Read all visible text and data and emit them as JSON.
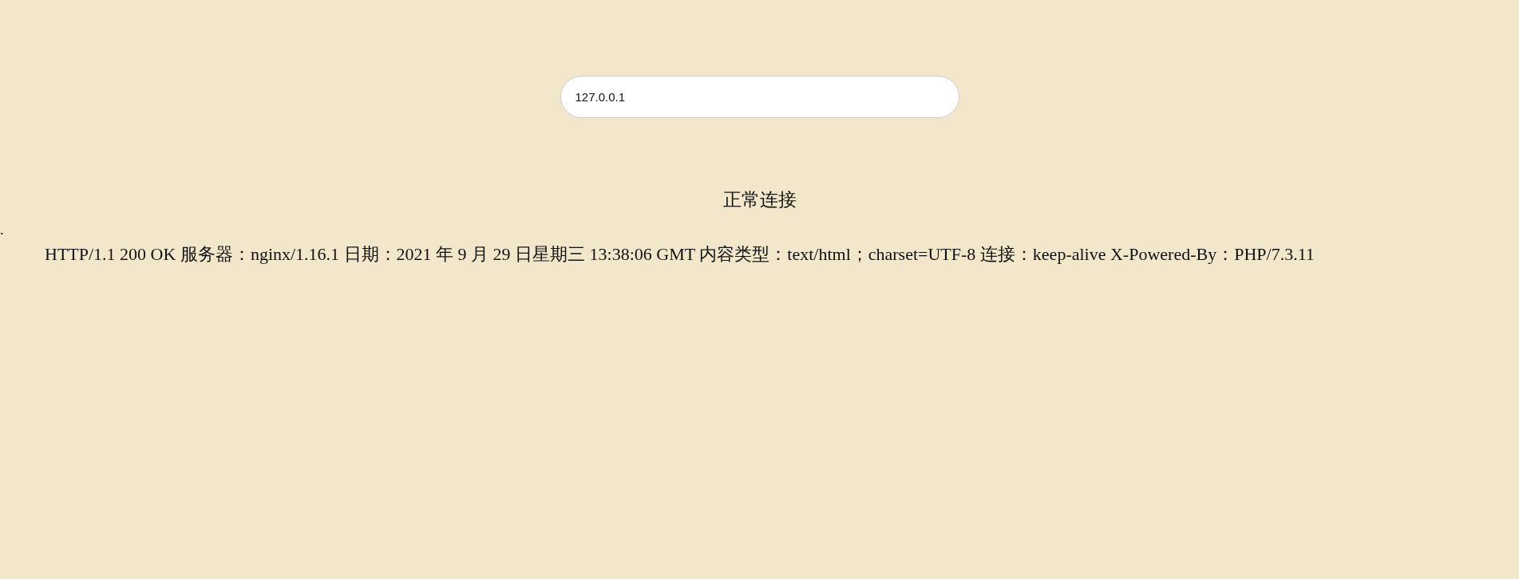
{
  "search": {
    "value": "127.0.0.1"
  },
  "status": "正常连接",
  "separator": ".",
  "response_headers": "HTTP/1.1 200 OK 服务器：nginx/1.16.1 日期：2021 年 9 月 29 日星期三 13:38:06 GMT 内容类型：text/html；charset=UTF-8 连接：keep-alive X-Powered-By：PHP/7.3.11"
}
